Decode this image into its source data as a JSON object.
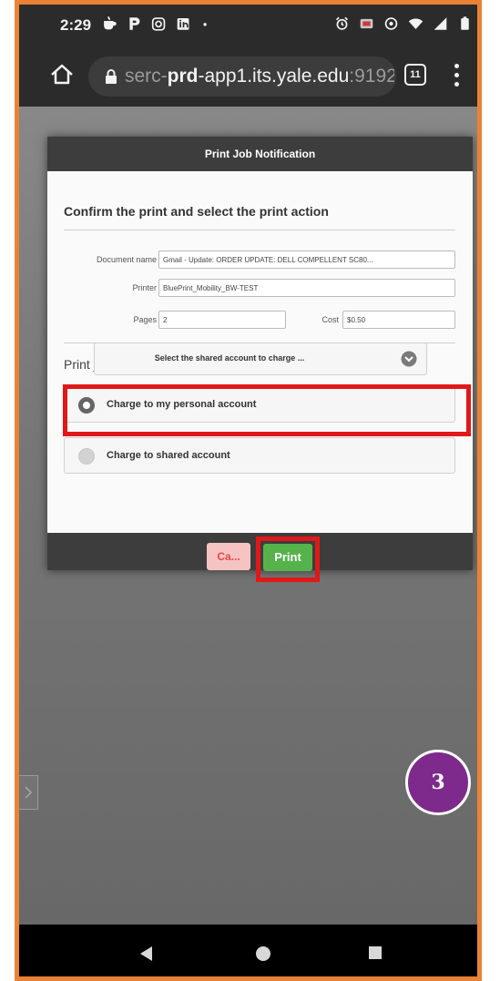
{
  "status_bar": {
    "time": "2:29"
  },
  "browser": {
    "url_prefix": "serc-",
    "url_bold": "prd",
    "url_host": "-app1.its.yale.edu",
    "url_port": ":9192",
    "tab_count": "11"
  },
  "dialog": {
    "title": "Print Job Notification",
    "confirm_heading": "Confirm the print and select the print action",
    "fields": {
      "document_label": "Document name",
      "document_value": "Gmail - Update: ORDER UPDATE: DELL COMPELLENT SC80...",
      "printer_label": "Printer",
      "printer_value": "BluePrint_Mobility_BW-TEST",
      "pages_label": "Pages",
      "pages_value": "2",
      "cost_label": "Cost",
      "cost_value": "$0.50"
    },
    "actions_heading": "Print job actions",
    "option_personal": "Charge to my personal account",
    "option_shared": "Charge to shared account",
    "shared_select_placeholder": "Select the shared account to charge ...",
    "cancel_label": "Ca...",
    "print_label": "Print"
  },
  "step_badge": "3",
  "colors": {
    "highlight": "#e01818",
    "print_button": "#56b24a",
    "badge": "#7d2a8c",
    "frame": "#e98236"
  }
}
